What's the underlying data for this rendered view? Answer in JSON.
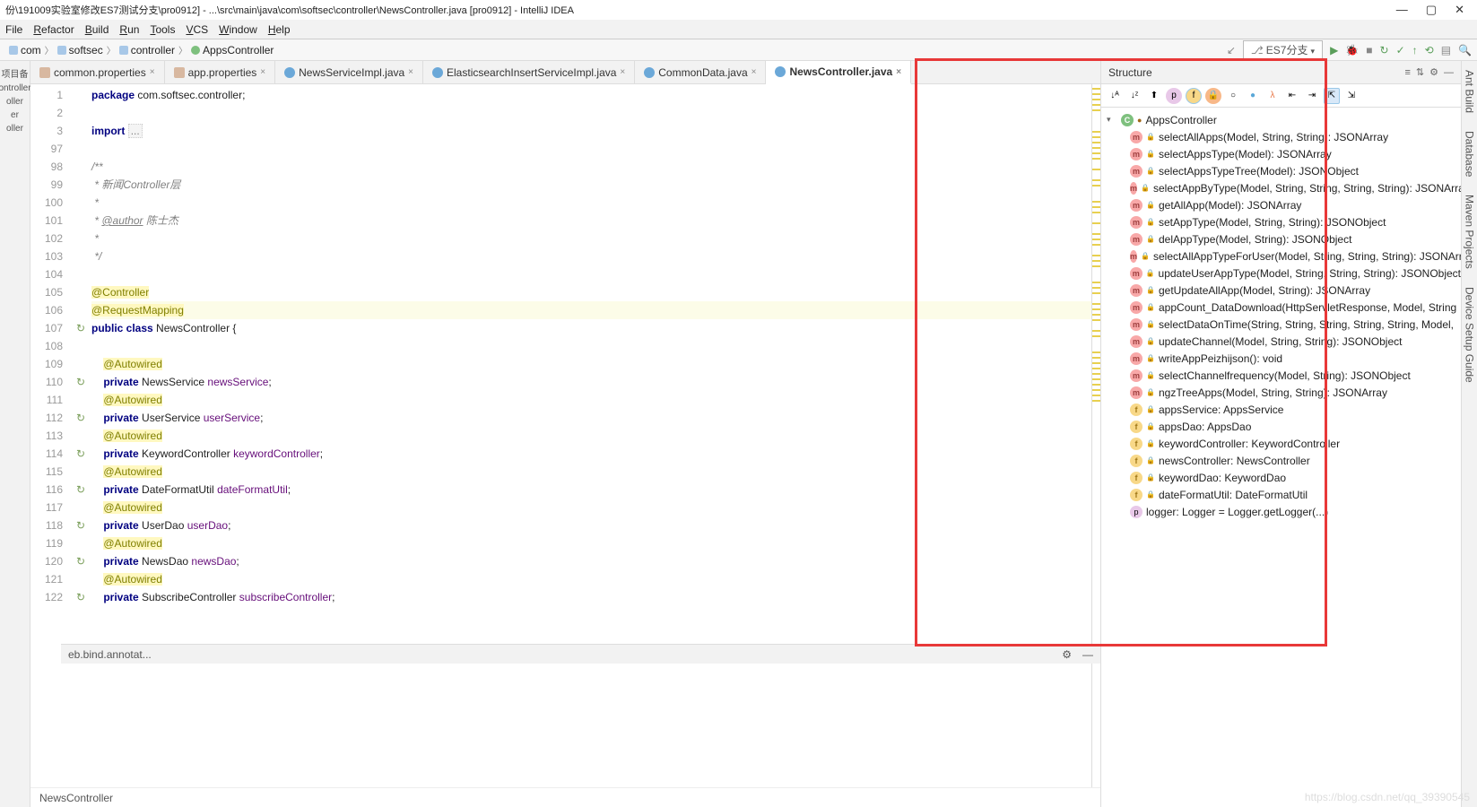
{
  "window": {
    "title": "份\\191009实验室修改ES7测试分支\\pro0912] - ...\\src\\main\\java\\com\\softsec\\controller\\NewsController.java [pro0912] - IntelliJ IDEA"
  },
  "menu": [
    "File",
    "Refactor",
    "Build",
    "Run",
    "Tools",
    "VCS",
    "Window",
    "Help"
  ],
  "breadcrumbs": [
    {
      "label": "com",
      "icon": "folder"
    },
    {
      "label": "softsec",
      "icon": "folder"
    },
    {
      "label": "controller",
      "icon": "folder"
    },
    {
      "label": "AppsController",
      "icon": "class"
    }
  ],
  "git_branch": "ES7分支",
  "left_stubs": [
    "项目备",
    "ontroller",
    "oller",
    "er",
    "oller"
  ],
  "tabs": [
    {
      "label": "common.properties",
      "icon": "prop"
    },
    {
      "label": "app.properties",
      "icon": "prop"
    },
    {
      "label": "NewsServiceImpl.java",
      "icon": "class"
    },
    {
      "label": "ElasticsearchInsertServiceImpl.java",
      "icon": "class"
    },
    {
      "label": "CommonData.java",
      "icon": "class"
    },
    {
      "label": "NewsController.java",
      "icon": "class",
      "active": true
    }
  ],
  "gutter_lines": [
    "1",
    "2",
    "3",
    "97",
    "98",
    "99",
    "100",
    "101",
    "102",
    "103",
    "104",
    "105",
    "106",
    "107",
    "108",
    "109",
    "110",
    "111",
    "112",
    "113",
    "114",
    "115",
    "116",
    "117",
    "118",
    "119",
    "120",
    "121",
    "122"
  ],
  "gutter_icons": {
    "107": "↻",
    "110": "↻",
    "112": "↻",
    "114": "↻",
    "116": "↻",
    "118": "↻",
    "120": "↻",
    "122": "↻"
  },
  "code_lines": [
    {
      "n": "1",
      "html": "<span class='kw'>package</span> com.softsec.controller;"
    },
    {
      "n": "2",
      "html": ""
    },
    {
      "n": "3",
      "html": "<span class='kw'>import</span> <span class='lit'>...</span>"
    },
    {
      "n": "97",
      "html": ""
    },
    {
      "n": "98",
      "html": "<span class='cmt'>/**</span>"
    },
    {
      "n": "99",
      "html": "<span class='cmt'> * 新闻Controller层</span>"
    },
    {
      "n": "100",
      "html": "<span class='cmt'> *</span>"
    },
    {
      "n": "101",
      "html": "<span class='cmt'> * <u>@author</u> 陈士杰</span>"
    },
    {
      "n": "102",
      "html": "<span class='cmt'> *</span>"
    },
    {
      "n": "103",
      "html": "<span class='cmt'> */</span>"
    },
    {
      "n": "104",
      "html": ""
    },
    {
      "n": "105",
      "html": "<span class='ann'>@Controller</span>"
    },
    {
      "n": "106",
      "html": "<span class='line-hl'><span class='ann'>@RequestMapping</span></span>"
    },
    {
      "n": "107",
      "html": "<span class='kw'>public class</span> NewsController {"
    },
    {
      "n": "108",
      "html": ""
    },
    {
      "n": "109",
      "html": "    <span class='ann'>@Autowired</span>"
    },
    {
      "n": "110",
      "html": "    <span class='kw'>private</span> NewsService <span class='id'>newsService</span>;"
    },
    {
      "n": "111",
      "html": "    <span class='ann'>@Autowired</span>"
    },
    {
      "n": "112",
      "html": "    <span class='kw'>private</span> UserService <span class='id'>userService</span>;"
    },
    {
      "n": "113",
      "html": "    <span class='ann'>@Autowired</span>"
    },
    {
      "n": "114",
      "html": "    <span class='kw'>private</span> KeywordController <span class='id'>keywordController</span>;"
    },
    {
      "n": "115",
      "html": "    <span class='ann'>@Autowired</span>"
    },
    {
      "n": "116",
      "html": "    <span class='kw'>private</span> DateFormatUtil <span class='id'>dateFormatUtil</span>;"
    },
    {
      "n": "117",
      "html": "    <span class='ann'>@Autowired</span>"
    },
    {
      "n": "118",
      "html": "    <span class='kw'>private</span> UserDao <span class='id'>userDao</span>;"
    },
    {
      "n": "119",
      "html": "    <span class='ann'>@Autowired</span>"
    },
    {
      "n": "120",
      "html": "    <span class='kw'>private</span> NewsDao <span class='id'>newsDao</span>;"
    },
    {
      "n": "121",
      "html": "    <span class='ann'>@Autowired</span>"
    },
    {
      "n": "122",
      "html": "    <span class='kw'>private</span> SubscribeController <span class='id'>subscribeController</span>;"
    }
  ],
  "code_status": "NewsController",
  "bottom_status": "eb.bind.annotat...",
  "structure": {
    "title": "Structure",
    "root": "AppsController",
    "members": [
      {
        "kind": "m",
        "label": "selectAllApps(Model, String, String): JSONArray"
      },
      {
        "kind": "m",
        "label": "selectAppsType(Model): JSONArray"
      },
      {
        "kind": "m",
        "label": "selectAppsTypeTree(Model): JSONObject"
      },
      {
        "kind": "m",
        "label": "selectAppByType(Model, String, String, String, String): JSONArray"
      },
      {
        "kind": "m",
        "label": "getAllApp(Model): JSONArray"
      },
      {
        "kind": "m",
        "label": "setAppType(Model, String, String): JSONObject"
      },
      {
        "kind": "m",
        "label": "delAppType(Model, String): JSONObject"
      },
      {
        "kind": "m",
        "label": "selectAllAppTypeForUser(Model, String, String, String): JSONArray"
      },
      {
        "kind": "m",
        "label": "updateUserAppType(Model, String, String, String): JSONObject"
      },
      {
        "kind": "m",
        "label": "getUpdateAllApp(Model, String): JSONArray"
      },
      {
        "kind": "m",
        "label": "appCount_DataDownload(HttpServletResponse, Model, String"
      },
      {
        "kind": "m",
        "label": "selectDataOnTime(String, String, String, String, String, Model, "
      },
      {
        "kind": "m",
        "label": "updateChannel(Model, String, String): JSONObject"
      },
      {
        "kind": "m",
        "label": "writeAppPeizhijson(): void"
      },
      {
        "kind": "m",
        "label": "selectChannelfrequency(Model, String): JSONObject"
      },
      {
        "kind": "m",
        "label": "ngzTreeApps(Model, String, String): JSONArray"
      },
      {
        "kind": "f",
        "label": "appsService: AppsService"
      },
      {
        "kind": "f",
        "label": "appsDao: AppsDao"
      },
      {
        "kind": "f",
        "label": "keywordController: KeywordController"
      },
      {
        "kind": "f",
        "label": "newsController: NewsController"
      },
      {
        "kind": "f",
        "label": "keywordDao: KeywordDao"
      },
      {
        "kind": "f",
        "label": "dateFormatUtil: DateFormatUtil"
      },
      {
        "kind": "p",
        "label": "logger: Logger = Logger.getLogger(...)"
      }
    ]
  },
  "right_stubs": [
    "Ant Build",
    "Database",
    "Maven Projects",
    "Device Setup Guide"
  ],
  "watermark": "https://blog.csdn.net/qq_39390545"
}
